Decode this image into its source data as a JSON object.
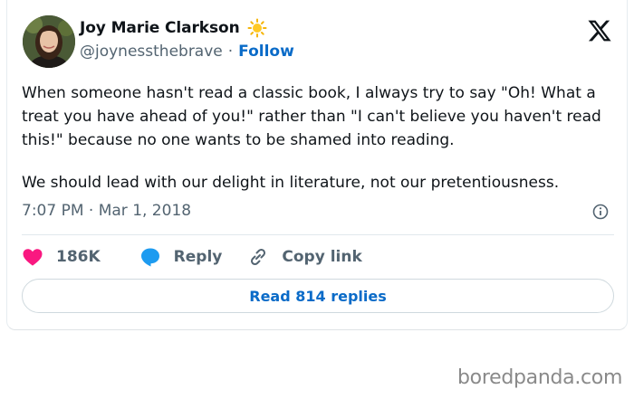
{
  "author": {
    "name": "Joy Marie Clarkson",
    "handle": "@joynessthebrave",
    "separator": "·",
    "follow_label": "Follow",
    "badge_icon": "sun-emoji-icon"
  },
  "tweet": {
    "paragraphs": [
      "When someone hasn't read a classic book, I always try to say \"Oh! What a treat you have ahead of you!\" rather than \"I can't believe you haven't read this!\" because no one wants to be shamed into reading.",
      "We should lead with our delight in literature, not our pretentiousness."
    ],
    "timestamp": "7:07 PM · Mar 1, 2018"
  },
  "actions": {
    "likes_count": "186K",
    "reply_label": "Reply",
    "copy_link_label": "Copy link"
  },
  "replies_button_label": "Read 814 replies",
  "watermark": "boredpanda.com",
  "colors": {
    "link_blue": "#0a6bc8",
    "heart_pink": "#f91880",
    "reply_blue": "#1d9bf0",
    "muted_gray": "#536471"
  }
}
